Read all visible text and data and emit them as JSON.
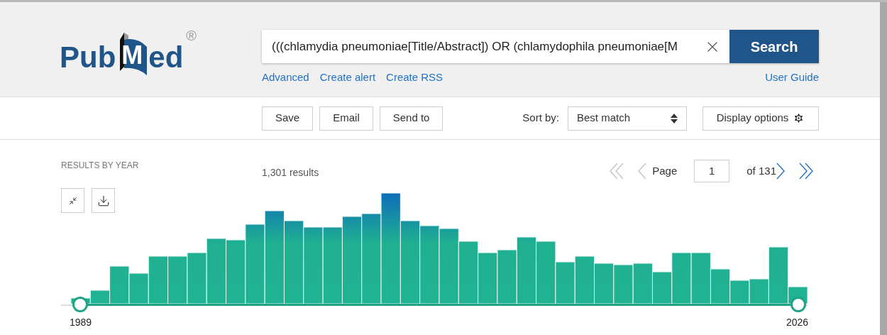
{
  "header": {
    "logo": {
      "parts": [
        "Pub",
        "M",
        "ed"
      ],
      "mark": "®"
    },
    "search": {
      "value": "(((chlamydia pneumoniae[Title/Abstract]) OR (chlamydophila pneumoniae[M",
      "button": "Search"
    },
    "links": [
      "Advanced",
      "Create alert",
      "Create RSS"
    ],
    "user_guide": "User Guide"
  },
  "toolbar": {
    "actions": [
      "Save",
      "Email",
      "Send to"
    ],
    "sort_label": "Sort by:",
    "sort_value": "Best match",
    "display_options": "Display options"
  },
  "results": {
    "timeline_title": "RESULTS BY YEAR",
    "count": "1,301 results",
    "pagination": {
      "first": {
        "disabled": true
      },
      "prev": {
        "disabled": true
      },
      "page_label": "Page",
      "page_value": "1",
      "of_label": "of 131",
      "next": {
        "disabled": false
      },
      "last": {
        "disabled": false
      }
    },
    "range_start": "1989",
    "range_end": "2026"
  }
}
